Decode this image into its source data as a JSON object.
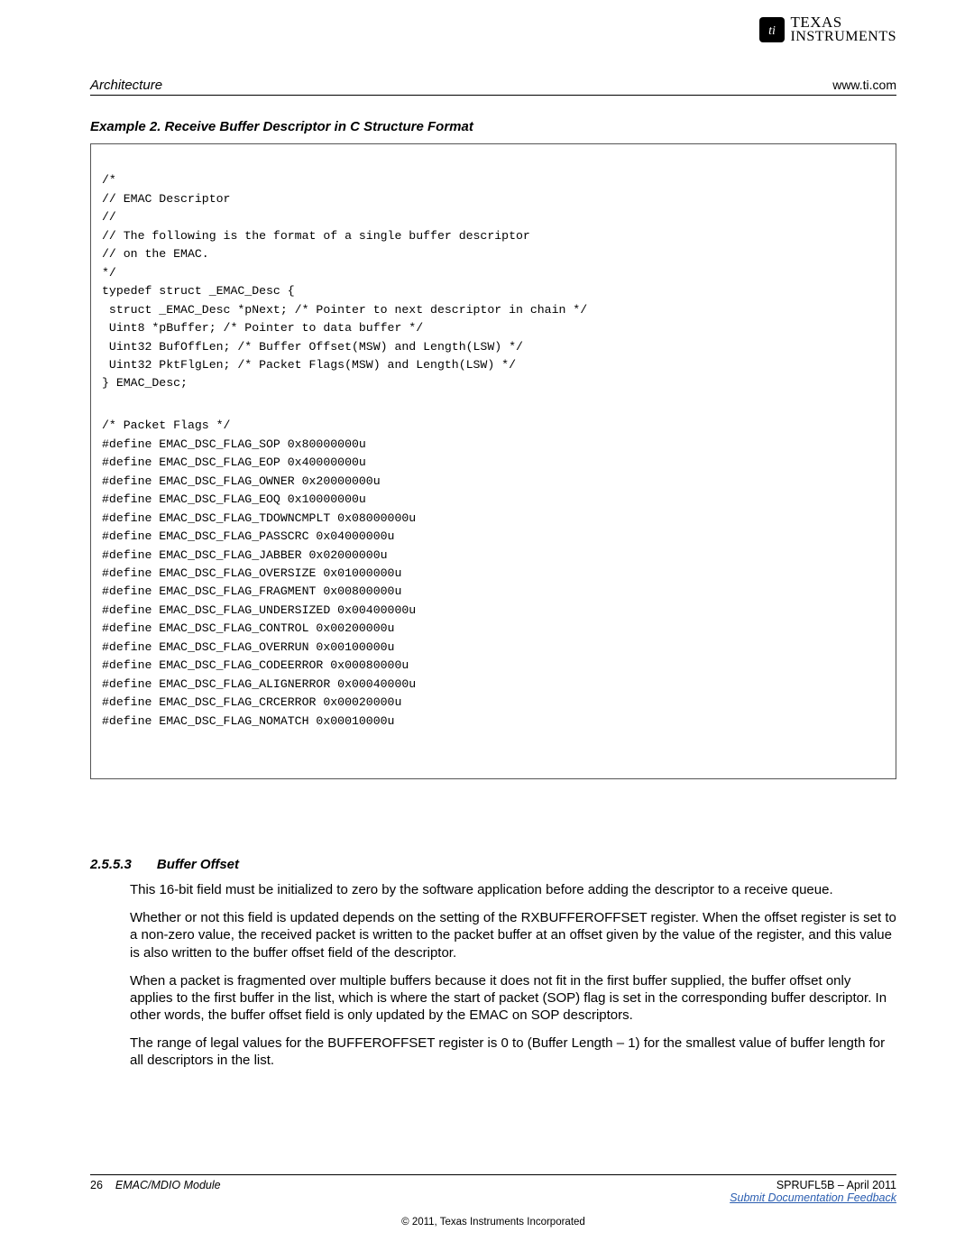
{
  "logo": {
    "line1": "TEXAS",
    "line2": "INSTRUMENTS",
    "chip_glyph": "✦"
  },
  "header": {
    "left": "Architecture",
    "right": "www.ti.com"
  },
  "example": {
    "title": "Example 2. Receive Buffer Descriptor in C Structure Format"
  },
  "code": {
    "block1": "/*\n// EMAC Descriptor\n//\n// The following is the format of a single buffer descriptor\n// on the EMAC.\n*/\ntypedef struct _EMAC_Desc {\n struct _EMAC_Desc *pNext; /* Pointer to next descriptor in chain */\n Uint8 *pBuffer; /* Pointer to data buffer */\n Uint32 BufOffLen; /* Buffer Offset(MSW) and Length(LSW) */\n Uint32 PktFlgLen; /* Packet Flags(MSW) and Length(LSW) */\n} EMAC_Desc;",
    "block2": "/* Packet Flags */\n#define EMAC_DSC_FLAG_SOP 0x80000000u\n#define EMAC_DSC_FLAG_EOP 0x40000000u\n#define EMAC_DSC_FLAG_OWNER 0x20000000u\n#define EMAC_DSC_FLAG_EOQ 0x10000000u\n#define EMAC_DSC_FLAG_TDOWNCMPLT 0x08000000u\n#define EMAC_DSC_FLAG_PASSCRC 0x04000000u\n#define EMAC_DSC_FLAG_JABBER 0x02000000u\n#define EMAC_DSC_FLAG_OVERSIZE 0x01000000u\n#define EMAC_DSC_FLAG_FRAGMENT 0x00800000u\n#define EMAC_DSC_FLAG_UNDERSIZED 0x00400000u\n#define EMAC_DSC_FLAG_CONTROL 0x00200000u\n#define EMAC_DSC_FLAG_OVERRUN 0x00100000u\n#define EMAC_DSC_FLAG_CODEERROR 0x00080000u\n#define EMAC_DSC_FLAG_ALIGNERROR 0x00040000u\n#define EMAC_DSC_FLAG_CRCERROR 0x00020000u\n#define EMAC_DSC_FLAG_NOMATCH 0x00010000u"
  },
  "section": {
    "number": "2.5.5.3",
    "title": "Buffer Offset",
    "paragraphs": [
      "This 16-bit field must be initialized to zero by the software application before adding the descriptor to a receive queue.",
      "Whether or not this field is updated depends on the setting of the RXBUFFEROFFSET register. When the offset register is set to a non-zero value, the received packet is written to the packet buffer at an offset given by the value of the register, and this value is also written to the buffer offset field of the descriptor.",
      "When a packet is fragmented over multiple buffers because it does not fit in the first buffer supplied, the buffer offset only applies to the first buffer in the list, which is where the start of packet (SOP) flag is set in the corresponding buffer descriptor. In other words, the buffer offset field is only updated by the EMAC on SOP descriptors.",
      "The range of legal values for the BUFFEROFFSET register is 0 to (Buffer Length – 1) for the smallest value of buffer length for all descriptors in the list."
    ]
  },
  "footer": {
    "page_number": "26",
    "doc_title": "EMAC/MDIO Module",
    "doc_id": "SPRUFL5B – April 2011",
    "feedback": "Submit Documentation Feedback",
    "copyright": "© 2011, Texas Instruments Incorporated"
  }
}
